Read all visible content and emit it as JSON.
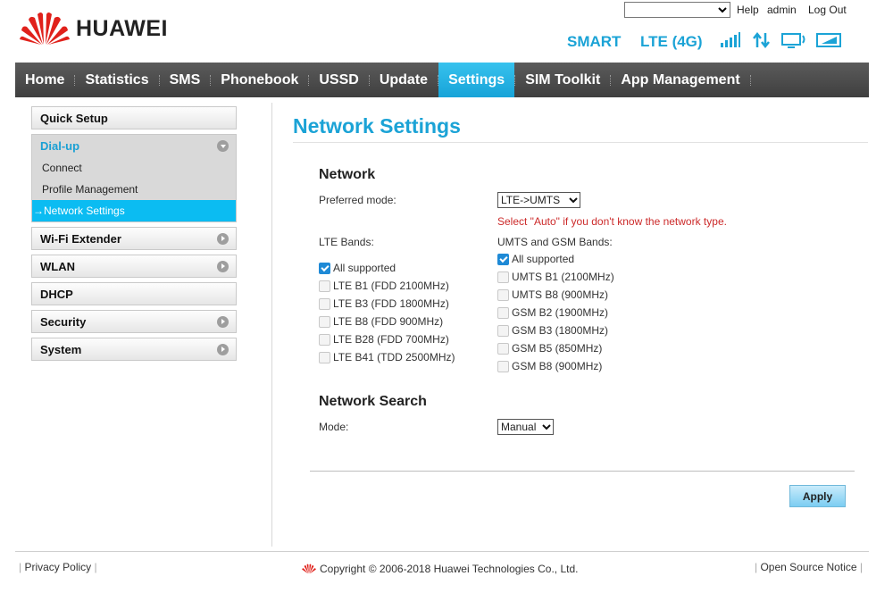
{
  "header": {
    "brand": "HUAWEI",
    "language_select_value": "",
    "links": {
      "help": "Help",
      "admin": "admin",
      "logout": "Log Out"
    },
    "status": {
      "operator": "SMART",
      "network_type": "LTE (4G)"
    },
    "icons": [
      "signal-bars-icon",
      "data-transfer-icon",
      "computer-connection-icon",
      "battery-icon"
    ]
  },
  "nav": {
    "items": [
      {
        "label": "Home"
      },
      {
        "label": "Statistics"
      },
      {
        "label": "SMS"
      },
      {
        "label": "Phonebook"
      },
      {
        "label": "USSD"
      },
      {
        "label": "Update"
      },
      {
        "label": "Settings",
        "active": true
      },
      {
        "label": "SIM Toolkit"
      },
      {
        "label": "App Management"
      }
    ]
  },
  "sidebar": {
    "items": [
      {
        "label": "Quick Setup"
      },
      {
        "label": "Dial-up",
        "expanded": true,
        "children": [
          {
            "label": "Connect"
          },
          {
            "label": "Profile Management"
          },
          {
            "label": "Network Settings",
            "active": true,
            "prefix": "→"
          }
        ]
      },
      {
        "label": "Wi-Fi Extender"
      },
      {
        "label": "WLAN"
      },
      {
        "label": "DHCP"
      },
      {
        "label": "Security"
      },
      {
        "label": "System"
      }
    ]
  },
  "main": {
    "title": "Network Settings",
    "network": {
      "heading": "Network",
      "preferred_mode_label": "Preferred mode:",
      "preferred_mode_value": "LTE->UMTS",
      "hint": "Select \"Auto\" if you don't know the network type.",
      "lte_bands_label": "LTE Bands:",
      "lte_bands": [
        {
          "label": "All supported",
          "checked": true
        },
        {
          "label": "LTE B1 (FDD 2100MHz)",
          "checked": false
        },
        {
          "label": "LTE B3 (FDD 1800MHz)",
          "checked": false
        },
        {
          "label": "LTE B8 (FDD 900MHz)",
          "checked": false
        },
        {
          "label": "LTE B28 (FDD 700MHz)",
          "checked": false
        },
        {
          "label": "LTE B41 (TDD 2500MHz)",
          "checked": false
        }
      ],
      "umts_bands_label": "UMTS and GSM Bands:",
      "umts_bands": [
        {
          "label": "All supported",
          "checked": true
        },
        {
          "label": "UMTS B1 (2100MHz)",
          "checked": false
        },
        {
          "label": "UMTS B8 (900MHz)",
          "checked": false
        },
        {
          "label": "GSM B2 (1900MHz)",
          "checked": false
        },
        {
          "label": "GSM B3 (1800MHz)",
          "checked": false
        },
        {
          "label": "GSM B5 (850MHz)",
          "checked": false
        },
        {
          "label": "GSM B8 (900MHz)",
          "checked": false
        }
      ]
    },
    "search": {
      "heading": "Network Search",
      "mode_label": "Mode:",
      "mode_value": "Manual"
    },
    "apply_label": "Apply"
  },
  "footer": {
    "privacy": "Privacy Policy",
    "copyright": "Copyright © 2006-2018 Huawei Technologies Co., Ltd.",
    "open_source": "Open Source Notice"
  },
  "colors": {
    "accent": "#1ba3d6",
    "nav_bg": "#4a4a4a",
    "nav_active": "#22b0e3",
    "hint": "#cc2a2a"
  }
}
